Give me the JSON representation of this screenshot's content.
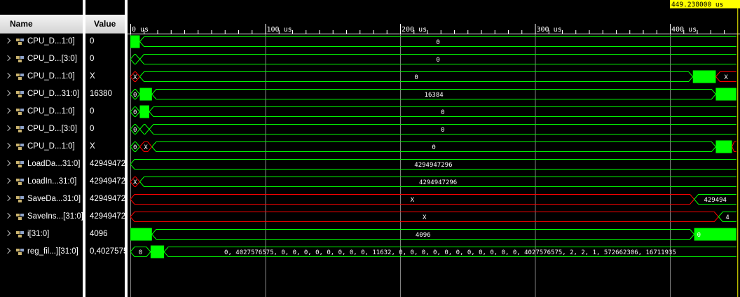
{
  "header": {
    "name_label": "Name",
    "value_label": "Value"
  },
  "cursor_time": "449.238000 us",
  "time_axis": {
    "unit": "us",
    "tick_labels": [
      "0 us",
      "100 us",
      "200 us",
      "300 us",
      "400 us"
    ],
    "tick_values": [
      0,
      100,
      200,
      300,
      400
    ],
    "end_time": 449.238
  },
  "colors": {
    "valid": "#00ff00",
    "undefined": "#ff0000",
    "cursor": "#ffff00",
    "grid": "#808080"
  },
  "signals": [
    {
      "name": "CPU_D...1:0]",
      "value": "0",
      "segments": [
        {
          "start": 0,
          "end": 7,
          "type": "fill",
          "label": ""
        },
        {
          "start": 7,
          "end": 449.238,
          "type": "bus",
          "label": "0"
        }
      ]
    },
    {
      "name": "CPU_D...[3:0]",
      "value": "0",
      "segments": [
        {
          "start": 0,
          "end": 7,
          "type": "bus",
          "label": ""
        },
        {
          "start": 7,
          "end": 449.238,
          "type": "bus",
          "label": "0"
        }
      ]
    },
    {
      "name": "CPU_D...1:0]",
      "value": "X",
      "segments": [
        {
          "start": 0,
          "end": 7,
          "type": "xbus",
          "label": "X"
        },
        {
          "start": 7,
          "end": 417,
          "type": "bus",
          "label": "0"
        },
        {
          "start": 417,
          "end": 434,
          "type": "fill",
          "label": ""
        },
        {
          "start": 434,
          "end": 449.238,
          "type": "xbus",
          "label": "X"
        }
      ]
    },
    {
      "name": "CPU_D...31:0]",
      "value": "16380",
      "segments": [
        {
          "start": 0,
          "end": 7,
          "type": "bus",
          "label": "0"
        },
        {
          "start": 7,
          "end": 16,
          "type": "fill",
          "label": ""
        },
        {
          "start": 16,
          "end": 434,
          "type": "bus",
          "label": "16384"
        },
        {
          "start": 434,
          "end": 449.238,
          "type": "fill",
          "label": ""
        }
      ]
    },
    {
      "name": "CPU_D...1:0]",
      "value": "0",
      "segments": [
        {
          "start": 0,
          "end": 7,
          "type": "bus",
          "label": "0"
        },
        {
          "start": 7,
          "end": 14,
          "type": "fill",
          "label": ""
        },
        {
          "start": 14,
          "end": 449.238,
          "type": "bus",
          "label": "0"
        }
      ]
    },
    {
      "name": "CPU_D...[3:0]",
      "value": "0",
      "segments": [
        {
          "start": 0,
          "end": 7,
          "type": "bus",
          "label": "0"
        },
        {
          "start": 7,
          "end": 14,
          "type": "bus",
          "label": ""
        },
        {
          "start": 14,
          "end": 449.238,
          "type": "bus",
          "label": "0"
        }
      ]
    },
    {
      "name": "CPU_D...1:0]",
      "value": "X",
      "segments": [
        {
          "start": 0,
          "end": 7,
          "type": "bus",
          "label": "0"
        },
        {
          "start": 7,
          "end": 16,
          "type": "xbus",
          "label": "X"
        },
        {
          "start": 16,
          "end": 434,
          "type": "bus",
          "label": "0"
        },
        {
          "start": 434,
          "end": 446,
          "type": "fill",
          "label": ""
        },
        {
          "start": 446,
          "end": 449.238,
          "type": "xbus",
          "label": ""
        }
      ]
    },
    {
      "name": "LoadDa...31:0]",
      "value": "42949472",
      "segments": [
        {
          "start": 0,
          "end": 449.238,
          "type": "bus",
          "label": "4294947296"
        }
      ]
    },
    {
      "name": "LoadIn...31:0]",
      "value": "42949472",
      "segments": [
        {
          "start": 0,
          "end": 7,
          "type": "xbus",
          "label": "X"
        },
        {
          "start": 7,
          "end": 449.238,
          "type": "bus",
          "label": "4294947296"
        }
      ]
    },
    {
      "name": "SaveDa...31:0]",
      "value": "42949472",
      "segments": [
        {
          "start": 0,
          "end": 418,
          "type": "xbus",
          "label": "X"
        },
        {
          "start": 418,
          "end": 449.238,
          "type": "bus",
          "label": "429494"
        }
      ]
    },
    {
      "name": "SaveIns...[31:0]",
      "value": "42949472",
      "segments": [
        {
          "start": 0,
          "end": 436,
          "type": "xbus",
          "label": "X"
        },
        {
          "start": 436,
          "end": 449.238,
          "type": "bus",
          "label": "4"
        }
      ]
    },
    {
      "name": "i[31:0]",
      "value": "4096",
      "segments": [
        {
          "start": 0,
          "end": 16,
          "type": "fill",
          "label": ""
        },
        {
          "start": 16,
          "end": 418,
          "type": "bus",
          "label": "4096"
        },
        {
          "start": 418,
          "end": 449.238,
          "type": "fill",
          "label": "0"
        }
      ]
    },
    {
      "name": "reg_fil...][31:0]",
      "value": "0,4027575",
      "segments": [
        {
          "start": 0,
          "end": 15,
          "type": "bus",
          "label": "0"
        },
        {
          "start": 15,
          "end": 25,
          "type": "fill",
          "label": ""
        },
        {
          "start": 25,
          "end": 449.238,
          "type": "bus",
          "label": "0, 4027576575, 0, 0, 0, 0, 0, 0, 0, 0, 11632, 0, 0, 0, 0, 0, 0, 0, 0, 0, 0, 0, 4027576575, 2, 2, 1, 572662306, 16711935"
        }
      ]
    }
  ]
}
